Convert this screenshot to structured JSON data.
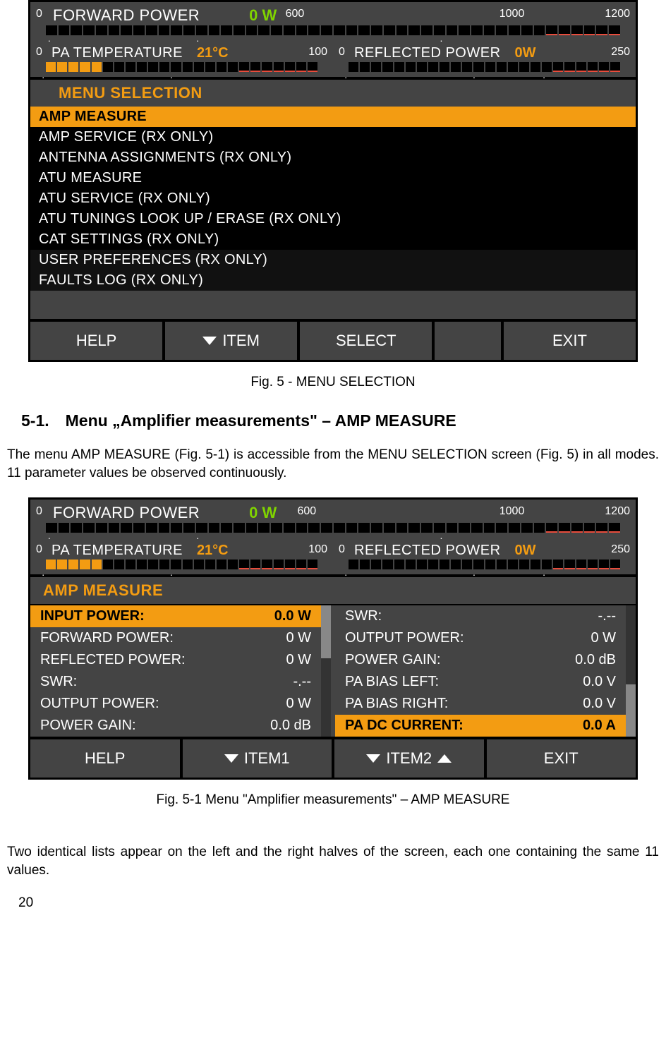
{
  "fig5": {
    "fwd": {
      "label": "FORWARD POWER",
      "value": "0 W",
      "ticks": [
        "0",
        "600",
        "1000",
        "1200"
      ]
    },
    "temp": {
      "label": "PA TEMPERATURE",
      "value": "21°C",
      "ticks": [
        "0",
        "100"
      ]
    },
    "refl": {
      "label": "REFLECTED POWER",
      "value": "0W",
      "ticks": [
        "0",
        "250"
      ]
    },
    "title": "MENU SELECTION",
    "items": [
      "AMP MEASURE",
      "AMP SERVICE (RX ONLY)",
      "ANTENNA ASSIGNMENTS (RX ONLY)",
      "ATU MEASURE",
      "ATU SERVICE (RX ONLY)",
      "ATU TUNINGS LOOK UP / ERASE (RX ONLY)",
      "CAT SETTINGS (RX ONLY)",
      "USER PREFERENCES (RX ONLY)",
      "FAULTS LOG (RX ONLY)"
    ],
    "footer": {
      "help": "HELP",
      "item": "ITEM",
      "select": "SELECT",
      "exit": "EXIT"
    }
  },
  "caption1": "Fig. 5 - MENU SELECTION",
  "heading": "5-1. Menu „Amplifier measurements\" – AMP MEASURE",
  "para1": "The menu AMP MEASURE (Fig. 5-1) is accessible from the MENU SELECTION screen (Fig. 5) in all modes. 11 parameter values be observed continuously.",
  "fig51": {
    "title": "AMP MEASURE",
    "left": [
      {
        "l": "INPUT POWER:",
        "v": "0.0 W",
        "sel": true
      },
      {
        "l": "FORWARD POWER:",
        "v": "0 W"
      },
      {
        "l": "REFLECTED POWER:",
        "v": "0 W"
      },
      {
        "l": "SWR:",
        "v": "-.--"
      },
      {
        "l": "OUTPUT POWER:",
        "v": "0 W"
      },
      {
        "l": "POWER GAIN:",
        "v": "0.0 dB"
      }
    ],
    "right": [
      {
        "l": "SWR:",
        "v": "-.--"
      },
      {
        "l": "OUTPUT POWER:",
        "v": "0 W"
      },
      {
        "l": "POWER GAIN:",
        "v": "0.0 dB"
      },
      {
        "l": "PA BIAS LEFT:",
        "v": "0.0 V"
      },
      {
        "l": "PA BIAS RIGHT:",
        "v": "0.0 V"
      },
      {
        "l": "PA DC CURRENT:",
        "v": "0.0 A",
        "sel": true
      }
    ],
    "footer": {
      "help": "HELP",
      "item1": "ITEM1",
      "item2": "ITEM2",
      "exit": "EXIT"
    }
  },
  "caption2": "Fig. 5-1 Menu \"Amplifier measurements\" – AMP MEASURE",
  "para2": "Two identical lists appear on the left and the right halves of the screen, each one containing the same 11 values.",
  "page": "20"
}
